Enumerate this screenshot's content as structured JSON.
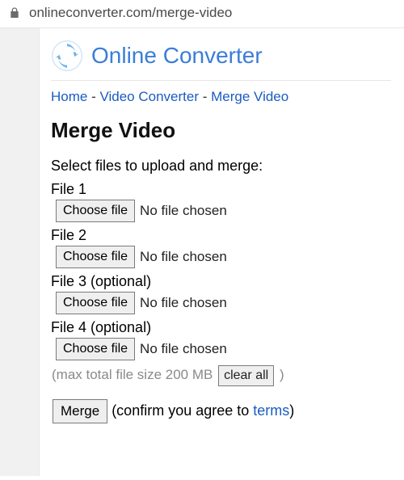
{
  "address": "onlineconverter.com/merge-video",
  "brand": {
    "title": "Online Converter"
  },
  "breadcrumb": {
    "home": "Home",
    "video_converter": "Video Converter",
    "merge_video": "Merge Video",
    "sep": " - "
  },
  "page_title": "Merge Video",
  "intro": "Select files to upload and merge:",
  "files": [
    {
      "label": "File 1",
      "button": "Choose file",
      "status": "No file chosen"
    },
    {
      "label": "File 2",
      "button": "Choose file",
      "status": "No file chosen"
    },
    {
      "label": "File 3 (optional)",
      "button": "Choose file",
      "status": "No file chosen"
    },
    {
      "label": "File 4 (optional)",
      "button": "Choose file",
      "status": "No file chosen"
    }
  ],
  "maxline": {
    "prefix": "(max total file size 200 MB ",
    "clear": "clear all",
    "suffix": " )"
  },
  "submit": {
    "merge": "Merge",
    "confirm_prefix": " (confirm you agree to ",
    "terms": "terms",
    "confirm_suffix": ")"
  }
}
